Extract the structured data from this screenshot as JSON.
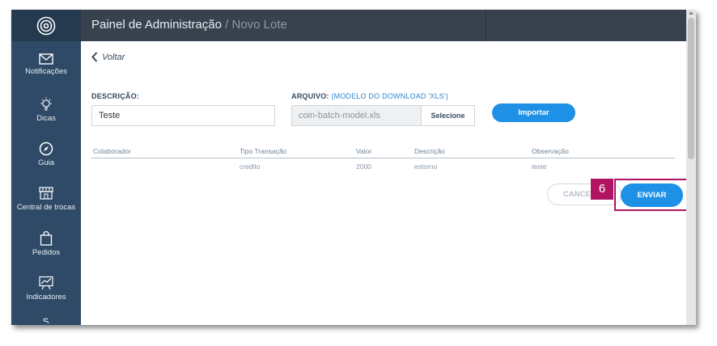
{
  "header": {
    "title": "Painel de Administração",
    "breadcrumb_separator": " / ",
    "subtitle": "Novo Lote"
  },
  "sidebar": {
    "items": [
      {
        "label": "Notificações",
        "icon": "envelope-icon"
      },
      {
        "label": "Dicas",
        "icon": "lightbulb-icon"
      },
      {
        "label": "Guia",
        "icon": "compass-icon"
      },
      {
        "label": "Central de trocas",
        "icon": "storefront-icon"
      },
      {
        "label": "Pedidos",
        "icon": "shopping-bag-icon"
      },
      {
        "label": "Indicadores",
        "icon": "chart-board-icon"
      }
    ]
  },
  "main": {
    "back_label": "Voltar",
    "description_label": "DESCRIÇÃO:",
    "description_value": "Teste",
    "file_label": "ARQUIVO:",
    "file_note": "(MODELO DO DOWNLOAD 'XLS')",
    "file_value": "coin-batch-model.xls",
    "select_label": "Selecione",
    "import_label": "Importar",
    "table": {
      "columns": [
        "Colaborador",
        "Tipo Transação",
        "Valor",
        "Descrição",
        "Observação"
      ],
      "rows": [
        [
          "",
          "credito",
          "2000",
          "estorno",
          "teste"
        ]
      ]
    },
    "cancel_label": "CANCEL",
    "submit_label": "ENVIAR"
  },
  "annotation": {
    "step_number": "6",
    "color": "#b01563"
  },
  "colors": {
    "sidebar": "#2e4a66",
    "topbar": "#37424e",
    "primary": "#1e90e6"
  }
}
